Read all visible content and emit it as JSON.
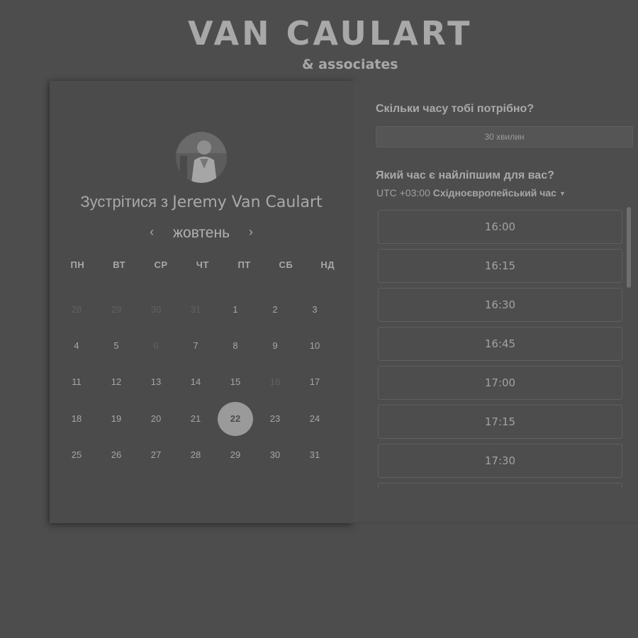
{
  "header": {
    "logo_text": "VAN CAULART",
    "logo_sub": "& associates"
  },
  "booking": {
    "meet_prefix": "Зустрітися з",
    "host_name": "Jeremy Van Caulart",
    "month": "жовтень",
    "prev_icon": "‹",
    "next_icon": "›",
    "weekdays": [
      "ПН",
      "ВТ",
      "СР",
      "ЧТ",
      "ПТ",
      "СБ",
      "НД"
    ],
    "weeks": [
      [
        {
          "d": "28",
          "muted": true
        },
        {
          "d": "29",
          "muted": true
        },
        {
          "d": "30",
          "muted": true
        },
        {
          "d": "31",
          "muted": true
        },
        {
          "d": "1"
        },
        {
          "d": "2"
        },
        {
          "d": "3"
        }
      ],
      [
        {
          "d": "4"
        },
        {
          "d": "5"
        },
        {
          "d": "6",
          "muted": true
        },
        {
          "d": "7"
        },
        {
          "d": "8"
        },
        {
          "d": "9"
        },
        {
          "d": "10"
        }
      ],
      [
        {
          "d": "11"
        },
        {
          "d": "12"
        },
        {
          "d": "13"
        },
        {
          "d": "14"
        },
        {
          "d": "15"
        },
        {
          "d": "16",
          "muted": true
        },
        {
          "d": "17"
        }
      ],
      [
        {
          "d": "18"
        },
        {
          "d": "19"
        },
        {
          "d": "20"
        },
        {
          "d": "21"
        },
        {
          "d": "22",
          "selected": true
        },
        {
          "d": "23"
        },
        {
          "d": "24"
        }
      ],
      [
        {
          "d": "25"
        },
        {
          "d": "26"
        },
        {
          "d": "27"
        },
        {
          "d": "28"
        },
        {
          "d": "29"
        },
        {
          "d": "30"
        },
        {
          "d": "31"
        }
      ]
    ]
  },
  "scheduling": {
    "duration_question": "Скільки часу тобі потрібно?",
    "duration_value": "30 хвилин",
    "time_question": "Який час є найліпшим для вас?",
    "timezone_offset": "UTC +03:00",
    "timezone_name": "Східноєвропейський час",
    "slots": [
      "16:00",
      "16:15",
      "16:30",
      "16:45",
      "17:00",
      "17:15",
      "17:30",
      ""
    ]
  }
}
